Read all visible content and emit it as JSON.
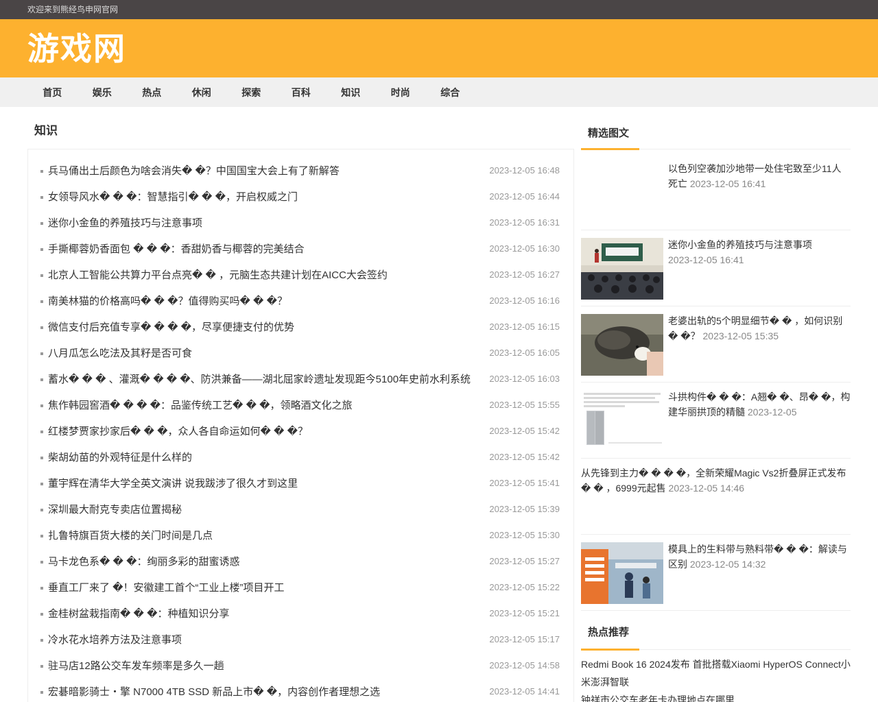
{
  "topbar": {
    "welcome": "欢迎来到熊经鸟申网官网"
  },
  "site": {
    "logo": "游戏网"
  },
  "nav": {
    "items": [
      "首页",
      "娱乐",
      "热点",
      "休闲",
      "探索",
      "百科",
      "知识",
      "时尚",
      "综合"
    ]
  },
  "main": {
    "title": "知识",
    "articles": [
      {
        "title": "兵马俑出土后颜色为啥会消失�  �？中国国宝大会上有了新解答",
        "date": "2023-12-05 16:48"
      },
      {
        "title": "女领导风水� � �：智慧指引� � �，开启权威之门",
        "date": "2023-12-05 16:44"
      },
      {
        "title": "迷你小金鱼的养殖技巧与注意事项",
        "date": "2023-12-05 16:31"
      },
      {
        "title": "手撕椰蓉奶香面包 � � �：香甜奶香与椰蓉的完美结合",
        "date": "2023-12-05 16:30"
      },
      {
        "title": "北京人工智能公共算力平台点亮� � ，元脑生态共建计划在AICC大会签约",
        "date": "2023-12-05 16:27"
      },
      {
        "title": "南美林猫的价格高吗� � �？值得购买吗� � �？",
        "date": "2023-12-05 16:16"
      },
      {
        "title": "微信支付后充值专享� � � �，尽享便捷支付的优势",
        "date": "2023-12-05 16:15"
      },
      {
        "title": "八月瓜怎么吃法及其籽是否可食",
        "date": "2023-12-05 16:05"
      },
      {
        "title": "蓄水� � � 、灌溉� � � �、防洪兼备——湖北屈家岭遗址发现距今5100年史前水利系统",
        "date": "2023-12-05 16:03"
      },
      {
        "title": "焦作韩园窖酒� � � �：品鉴传统工艺� � �，领略酒文化之旅",
        "date": "2023-12-05 15:55"
      },
      {
        "title": "红楼梦贾家抄家后� � �，众人各自命运如何� � �？",
        "date": "2023-12-05 15:42"
      },
      {
        "title": "柴胡幼苗的外观特征是什么样的",
        "date": "2023-12-05 15:42"
      },
      {
        "title": "董宇辉在清华大学全英文演讲 说我跋涉了很久才到这里",
        "date": "2023-12-05 15:41"
      },
      {
        "title": "深圳最大耐克专卖店位置揭秘",
        "date": "2023-12-05 15:39"
      },
      {
        "title": "扎鲁特旗百货大楼的关门时间是几点",
        "date": "2023-12-05 15:30"
      },
      {
        "title": "马卡龙色系� � �：绚丽多彩的甜蜜诱惑",
        "date": "2023-12-05 15:27"
      },
      {
        "title": "垂直工厂来了 �！安徽建工首个“工业上楼”项目开工",
        "date": "2023-12-05 15:22"
      },
      {
        "title": "金桂树盆栽指南� � �：种植知识分享",
        "date": "2023-12-05 15:21"
      },
      {
        "title": "冷水花水培养方法及注意事项",
        "date": "2023-12-05 15:17"
      },
      {
        "title": "驻马店12路公交车发车频率是多久一趟",
        "date": "2023-12-05 14:58"
      },
      {
        "title": "宏碁暗影骑士・擎 N7000 4TB SSD 新品上市� �，内容创作者理想之选",
        "date": "2023-12-05 14:41"
      }
    ]
  },
  "side": {
    "featured_title": "精选图文",
    "featured": [
      {
        "title": "以色列空袭加沙地带一处住宅致至少11人死亡",
        "date": "2023-12-05 16:41",
        "image": "none"
      },
      {
        "title": "迷你小金鱼的养殖技巧与注意事项",
        "date": "2023-12-05 16:41",
        "image": "classroom-photo"
      },
      {
        "title": "老婆出轨的5个明显细节� � ，如何识别� �？",
        "date": "2023-12-05 15:35",
        "image": "hedgehog-photo"
      },
      {
        "title": "斗拱构件� � �：A翘� �、昂� �，构建华丽拱顶的精髓",
        "date": "2023-12-05",
        "image": "phone-screenshot"
      },
      {
        "title": "从先锋到主力� � � �，全新荣耀Magic Vs2折叠屏正式发布� � ，6999元起售",
        "date": "2023-12-05 14:46",
        "image": "none"
      },
      {
        "title": "模具上的生料带与熟料带� � �：解读与区别",
        "date": "2023-12-05 14:32",
        "image": "service-area-photo"
      }
    ],
    "hot_title": "热点推荐",
    "hot": [
      "Redmi Book 16 2024发布 首批搭载Xiaomi HyperOS Connect小米澎湃智联",
      "钟祥市公交车老年卡办理地点在哪里"
    ]
  },
  "colors": {
    "accent": "#fdb12f",
    "topbar": "#4a4546",
    "nav": "#f0f0f0"
  }
}
